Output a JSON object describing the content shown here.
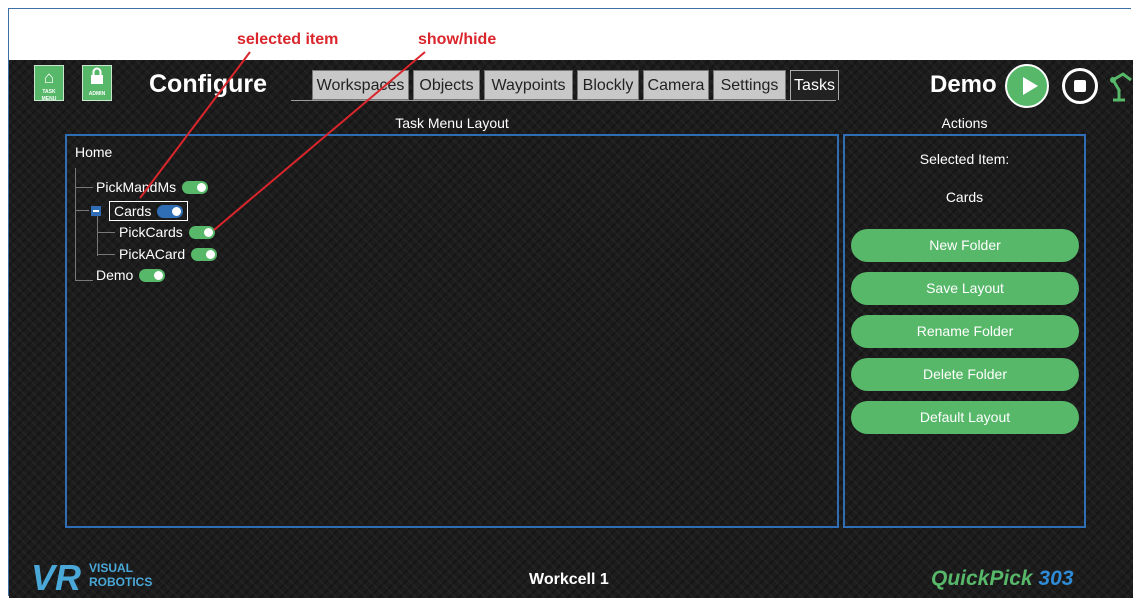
{
  "annotations": {
    "selected_item": "selected item",
    "show_hide": "show/hide"
  },
  "header": {
    "task_menu_label": "TASK MENU",
    "admin_label": "ADMIN",
    "title": "Configure",
    "tabs": [
      {
        "label": "Workspaces"
      },
      {
        "label": "Objects"
      },
      {
        "label": "Waypoints"
      },
      {
        "label": "Blockly"
      },
      {
        "label": "Camera"
      },
      {
        "label": "Settings"
      },
      {
        "label": "Tasks",
        "active": true
      }
    ],
    "workcell_name": "Demo"
  },
  "layout_panel": {
    "heading": "Task Menu Layout",
    "root": "Home",
    "items": [
      {
        "label": "PickMandMs",
        "visible": true
      },
      {
        "label": "Cards",
        "visible": true,
        "selected": true,
        "expanded": true,
        "children": [
          {
            "label": "PickCards",
            "visible": true
          },
          {
            "label": "PickACard",
            "visible": true
          }
        ]
      },
      {
        "label": "Demo",
        "visible": true
      }
    ]
  },
  "actions_panel": {
    "heading": "Actions",
    "selected_item_label": "Selected Item:",
    "selected_item_value": "Cards",
    "buttons": [
      {
        "label": "New Folder"
      },
      {
        "label": "Save Layout"
      },
      {
        "label": "Rename Folder"
      },
      {
        "label": "Delete Folder"
      },
      {
        "label": "Default Layout"
      }
    ]
  },
  "footer": {
    "logo_text_line1": "VISUAL",
    "logo_text_line2": "ROBOTICS",
    "workcell": "Workcell 1",
    "product_part1": "QuickPick",
    "product_part2": " 303"
  },
  "colors": {
    "accent_green": "#57b86a",
    "accent_blue": "#2f6db5",
    "annotation_red": "#d9252b",
    "background": "#1c1c1c"
  }
}
